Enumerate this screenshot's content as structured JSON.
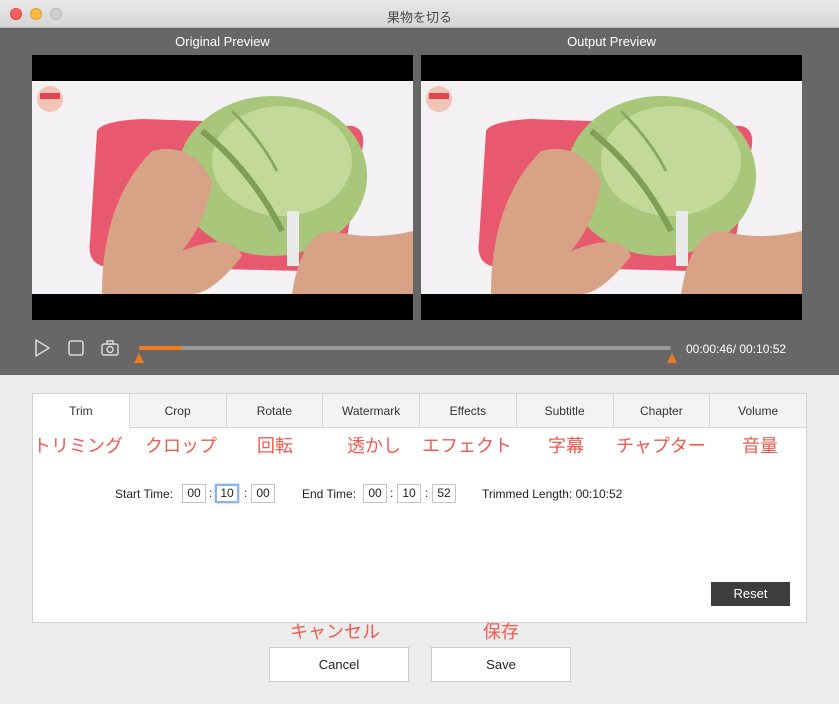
{
  "window": {
    "title": "果物を切る"
  },
  "preview": {
    "original_label": "Original Preview",
    "output_label": "Output  Preview"
  },
  "playback": {
    "time_readout": "00:00:46/ 00:10:52",
    "progress_fraction": 0.08,
    "accent_color": "#f07a1e"
  },
  "tabs": [
    {
      "label": "Trim",
      "jp": "トリミング",
      "active": true
    },
    {
      "label": "Crop",
      "jp": "クロップ",
      "active": false
    },
    {
      "label": "Rotate",
      "jp": "回転",
      "active": false
    },
    {
      "label": "Watermark",
      "jp": "透かし",
      "active": false
    },
    {
      "label": "Effects",
      "jp": "エフェクト",
      "active": false
    },
    {
      "label": "Subtitle",
      "jp": "字幕",
      "active": false
    },
    {
      "label": "Chapter",
      "jp": "チャプター",
      "active": false
    },
    {
      "label": "Volume",
      "jp": "音量",
      "active": false
    }
  ],
  "trim": {
    "start_label": "Start Time:",
    "start": [
      "00",
      "10",
      "00"
    ],
    "end_label": "End Time:",
    "end": [
      "00",
      "10",
      "52"
    ],
    "trimmed_length": "Trimmed Length: 00:10:52",
    "reset_label": "Reset"
  },
  "annotations": {
    "cancel_jp": "キャンセル",
    "save_jp": "保存"
  },
  "buttons": {
    "cancel": "Cancel",
    "save": "Save"
  }
}
